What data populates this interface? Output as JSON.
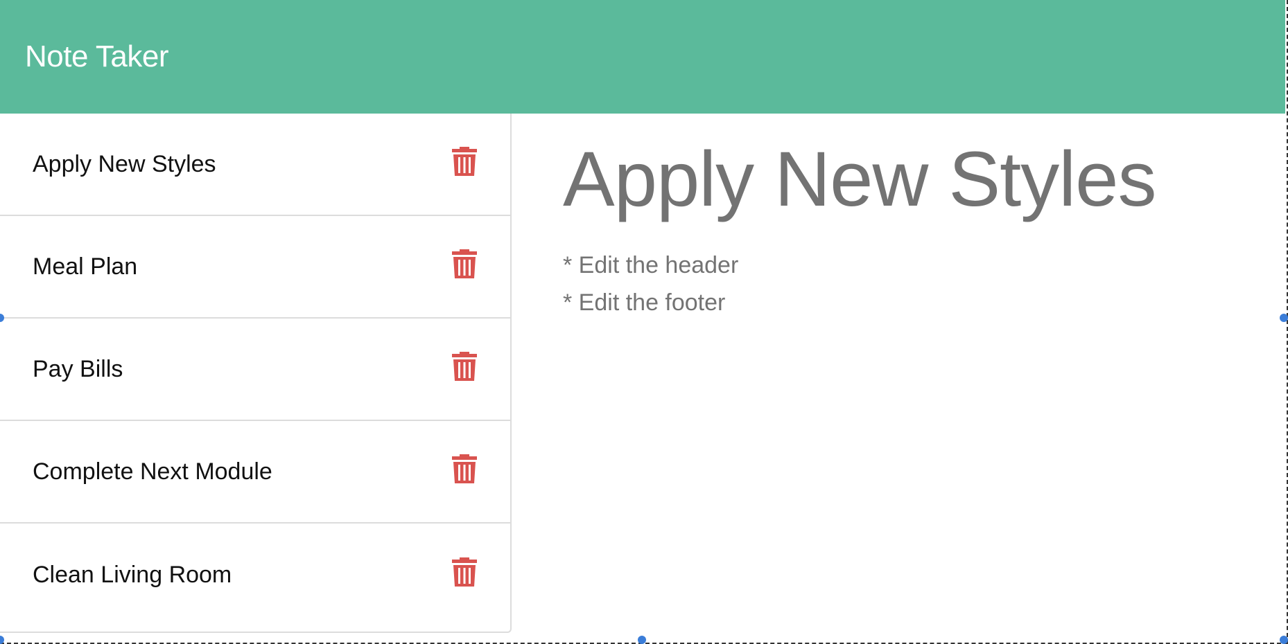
{
  "app": {
    "title": "Note Taker"
  },
  "notes": [
    {
      "title": "Apply New Styles"
    },
    {
      "title": "Meal Plan"
    },
    {
      "title": "Pay Bills"
    },
    {
      "title": "Complete Next Module"
    },
    {
      "title": "Clean Living Room"
    }
  ],
  "active_note": {
    "title": "Apply New Styles",
    "lines": [
      "* Edit the header",
      "* Edit the footer"
    ]
  },
  "icons": {
    "delete": "trash-icon"
  },
  "colors": {
    "navbar": "#5bba9b",
    "delete_icon": "#d9534f",
    "note_text": "#737373"
  }
}
